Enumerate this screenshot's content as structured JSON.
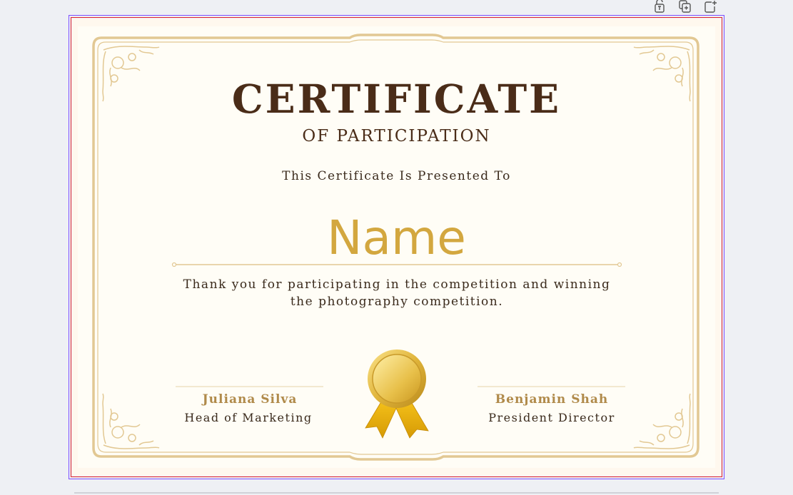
{
  "toolbar": {
    "icons": [
      "lock-icon",
      "duplicate-icon",
      "add-page-icon"
    ]
  },
  "certificate": {
    "title": "CERTIFICATE",
    "subtitle": "OF PARTICIPATION",
    "presented_to": "This Certificate Is Presented To",
    "recipient_name": "Name",
    "body_line1": "Thank you for participating in the competition and winning",
    "body_line2": "the photography competition.",
    "signer_left_name": "Juliana Silva",
    "signer_left_role": "Head of Marketing",
    "signer_right_name": "Benjamin Shah",
    "signer_right_role": "President Director"
  },
  "colors": {
    "frame_gold": "#e2c893",
    "title_brown": "#4a2c18",
    "name_gold": "#d3a73f",
    "selection_purple": "#7c4dff",
    "selection_red": "#e0212f"
  }
}
